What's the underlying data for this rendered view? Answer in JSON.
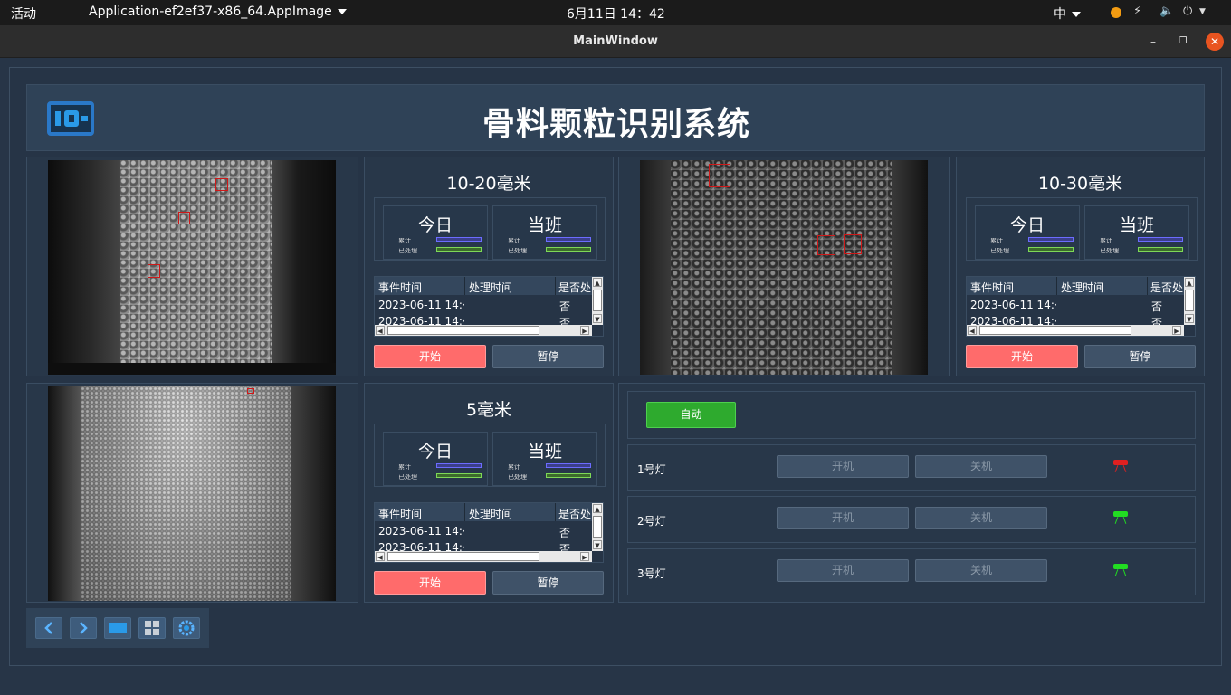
{
  "system": {
    "activities": "活动",
    "app_name": "Application-ef2ef37-x86_64.AppImage",
    "clock": "6月11日  14：42",
    "ime": "中"
  },
  "window": {
    "title": "MainWindow"
  },
  "header": {
    "title": "骨料颗粒识别系统"
  },
  "panels": [
    {
      "heading": "10-20毫米",
      "today_label": "今日",
      "shift_label": "当班",
      "columns": [
        "事件时间",
        "处理时间",
        "是否处"
      ],
      "rows": [
        {
          "event_time": "2023-06-11 14:···",
          "handled_time": "",
          "handled": "否"
        },
        {
          "event_time": "2023-06-11 14:···",
          "handled_time": "",
          "handled": "否"
        }
      ],
      "start_label": "开始",
      "pause_label": "暂停"
    },
    {
      "heading": "10-30毫米",
      "today_label": "今日",
      "shift_label": "当班",
      "columns": [
        "事件时间",
        "处理时间",
        "是否处"
      ],
      "rows": [
        {
          "event_time": "2023-06-11 14:···",
          "handled_time": "",
          "handled": "否"
        },
        {
          "event_time": "2023-06-11 14:···",
          "handled_time": "",
          "handled": "否"
        }
      ],
      "start_label": "开始",
      "pause_label": "暂停"
    },
    {
      "heading": "5毫米",
      "today_label": "今日",
      "shift_label": "当班",
      "columns": [
        "事件时间",
        "处理时间",
        "是否处"
      ],
      "rows": [
        {
          "event_time": "2023-06-11 14:···",
          "handled_time": "",
          "handled": "否"
        },
        {
          "event_time": "2023-06-11 14:···",
          "handled_time": "",
          "handled": "否"
        }
      ],
      "start_label": "开始",
      "pause_label": "暂停"
    }
  ],
  "control": {
    "auto_label": "自动",
    "lamps": [
      {
        "label": "1号灯",
        "on_label": "开机",
        "off_label": "关机",
        "status": "red",
        "status_color": "#e02020"
      },
      {
        "label": "2号灯",
        "on_label": "开机",
        "off_label": "关机",
        "status": "green",
        "status_color": "#22dd22"
      },
      {
        "label": "3号灯",
        "on_label": "开机",
        "off_label": "关机",
        "status": "green",
        "status_color": "#22dd22"
      }
    ]
  },
  "toolbar": {
    "icons": [
      "chevron-left-icon",
      "chevron-right-icon",
      "single-view-icon",
      "grid-view-icon",
      "settings-icon"
    ]
  },
  "colors": {
    "start_button": "#ff6b6b",
    "auto_button": "#2eaa2e",
    "accent_blue": "#2a9ae8"
  }
}
